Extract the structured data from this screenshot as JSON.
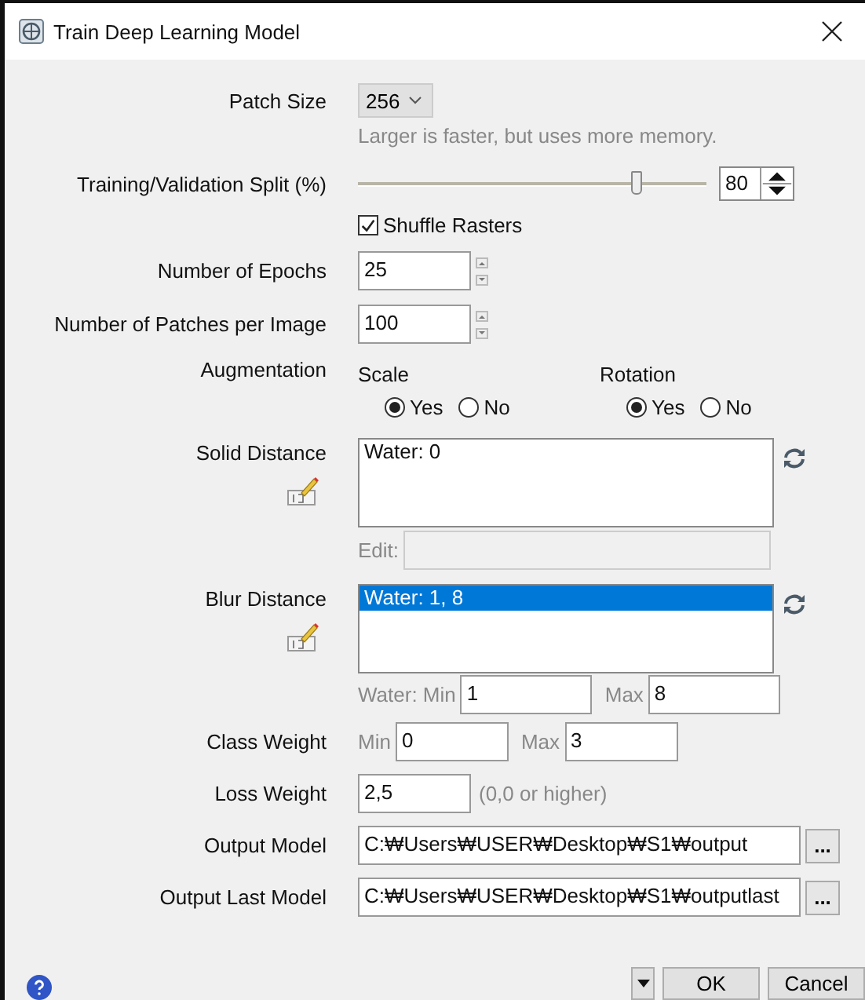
{
  "window": {
    "title": "Train Deep Learning Model"
  },
  "patch_size": {
    "label": "Patch Size",
    "value": "256",
    "hint": "Larger is faster, but uses more memory."
  },
  "split": {
    "label": "Training/Validation Split (%)",
    "level": 0.8,
    "value": "80"
  },
  "shuffle": {
    "label": "Shuffle Rasters",
    "checked": true
  },
  "epochs": {
    "label": "Number of Epochs",
    "value": "25"
  },
  "patches": {
    "label": "Number of Patches per Image",
    "value": "100"
  },
  "augmentation": {
    "label": "Augmentation",
    "groups": [
      {
        "title": "Scale",
        "options": [
          {
            "label": "Yes",
            "selected": true
          },
          {
            "label": "No",
            "selected": false
          }
        ]
      },
      {
        "title": "Rotation",
        "options": [
          {
            "label": "Yes",
            "selected": true
          },
          {
            "label": "No",
            "selected": false
          }
        ]
      }
    ]
  },
  "solid_distance": {
    "label": "Solid Distance",
    "items": [
      {
        "text": "Water: 0",
        "selected": false
      }
    ],
    "edit_label": "Edit:"
  },
  "blur_distance": {
    "label": "Blur Distance",
    "items": [
      {
        "text": "Water: 1,  8",
        "selected": true
      }
    ],
    "min_label": "Water:  Min",
    "min_value": "1",
    "max_label": "Max",
    "max_value": "8"
  },
  "class_weight": {
    "label": "Class Weight",
    "min_label": "Min",
    "min_value": "0",
    "max_label": "Max",
    "max_value": "3"
  },
  "loss_weight": {
    "label": "Loss Weight",
    "value": "2,5",
    "hint": "(0,0 or higher)"
  },
  "outputs": [
    {
      "label": "Output Model",
      "value": "C:₩Users₩USER₩Desktop₩S1₩output",
      "browse": "..."
    },
    {
      "label": "Output Last Model",
      "value": "C:₩Users₩USER₩Desktop₩S1₩outputlast",
      "browse": "..."
    }
  ],
  "buttons": [
    {
      "label": "OK"
    },
    {
      "label": "Cancel"
    }
  ]
}
